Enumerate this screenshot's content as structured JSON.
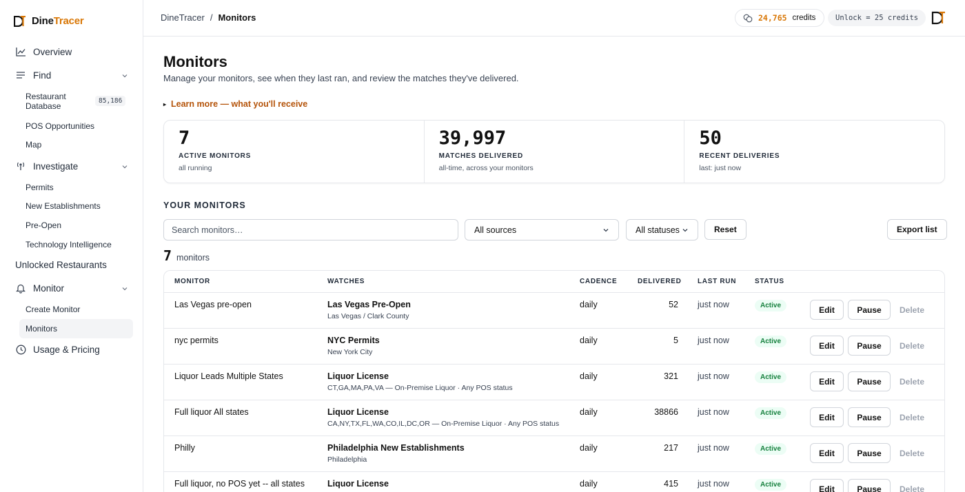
{
  "brand": {
    "part1": "Dine",
    "part2": "Tracer"
  },
  "sidebar": {
    "overview": "Overview",
    "find": "Find",
    "find_items": [
      "Restaurant Database",
      "POS Opportunities",
      "Map"
    ],
    "db_count": "85,186",
    "investigate": "Investigate",
    "investigate_items": [
      "Permits",
      "New Establishments",
      "Pre-Open",
      "Technology Intelligence"
    ],
    "unlocked": "Unlocked Restaurants",
    "monitor": "Monitor",
    "monitor_items": [
      "Create Monitor",
      "Monitors"
    ],
    "usage": "Usage & Pricing"
  },
  "topbar": {
    "breadcrumb_root": "DineTracer",
    "breadcrumb_sep": "/",
    "breadcrumb_current": "Monitors",
    "credits_value": "24,765",
    "credits_label": "credits",
    "unlock_text": "Unlock = 25 credits"
  },
  "page": {
    "title": "Monitors",
    "subtitle": "Manage your monitors, see when they last ran, and review the matches they've delivered.",
    "learn_more": "Learn more — what you'll receive",
    "learn_marker": "▸"
  },
  "stats": [
    {
      "value": "7",
      "label": "ACTIVE MONITORS",
      "hint": "all running"
    },
    {
      "value": "39,997",
      "label": "MATCHES DELIVERED",
      "hint": "all-time, across your monitors"
    },
    {
      "value": "50",
      "label": "RECENT DELIVERIES",
      "hint": "last: just now"
    }
  ],
  "section_title": "YOUR MONITORS",
  "filters": {
    "search_placeholder": "Search monitors…",
    "source_value": "All sources",
    "status_value": "All statuses",
    "reset": "Reset",
    "export": "Export list"
  },
  "count": {
    "number": "7",
    "label": "monitors"
  },
  "table": {
    "headers": [
      "MONITOR",
      "WATCHES",
      "CADENCE",
      "DELIVERED",
      "LAST RUN",
      "STATUS"
    ],
    "rows": [
      {
        "name": "Las Vegas pre-open",
        "watch": "Las Vegas Pre-Open",
        "detail": "Las Vegas / Clark County",
        "cadence": "daily",
        "delivered": "52",
        "last_run": "just now",
        "status": "Active"
      },
      {
        "name": "nyc permits",
        "watch": "NYC Permits",
        "detail": "New York City",
        "cadence": "daily",
        "delivered": "5",
        "last_run": "just now",
        "status": "Active"
      },
      {
        "name": "Liquor Leads Multiple States",
        "watch": "Liquor License",
        "detail": "CT,GA,MA,PA,VA — On-Premise Liquor · Any POS status",
        "cadence": "daily",
        "delivered": "321",
        "last_run": "just now",
        "status": "Active"
      },
      {
        "name": "Full liquor All states",
        "watch": "Liquor License",
        "detail": "CA,NY,TX,FL,WA,CO,IL,DC,OR — On-Premise Liquor · Any POS status",
        "cadence": "daily",
        "delivered": "38866",
        "last_run": "just now",
        "status": "Active"
      },
      {
        "name": "Philly",
        "watch": "Philadelphia New Establishments",
        "detail": "Philadelphia",
        "cadence": "daily",
        "delivered": "217",
        "last_run": "just now",
        "status": "Active"
      },
      {
        "name": "Full liquor, no POS yet -- all states",
        "watch": "Liquor License",
        "detail": "",
        "cadence": "daily",
        "delivered": "415",
        "last_run": "just now",
        "status": "Active"
      }
    ],
    "edit_label": "Edit",
    "pause_label": "Pause",
    "delete_label": "Delete"
  },
  "colors": {
    "accent": "#d97706",
    "active_badge_bg": "#ecfdf5",
    "active_badge_text": "#15803d"
  }
}
